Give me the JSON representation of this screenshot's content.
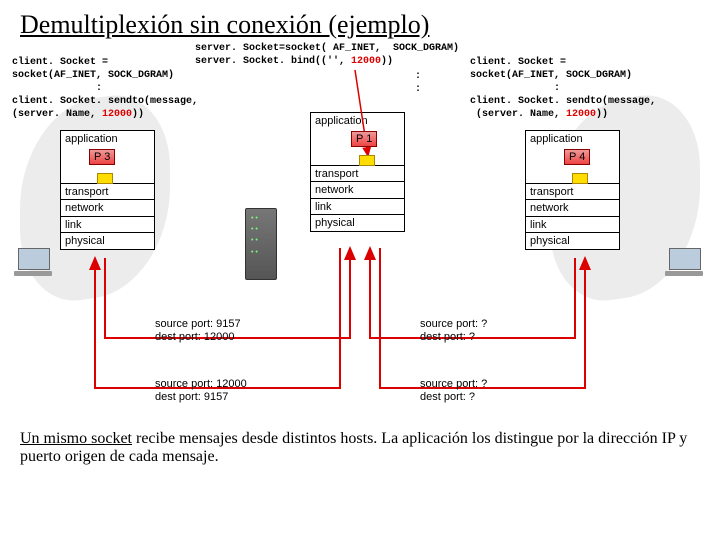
{
  "title": "Demultiplexión sin conexión (ejemplo)",
  "server_code_1": "server. Socket=socket( AF_INET,  SOCK_DGRAM)",
  "server_code_2": "server. Socket. bind(('', ",
  "server_code_2_port": "12000",
  "server_code_2_end": "))",
  "left_code_1": "client. Socket =",
  "left_code_2": "socket(AF_INET, SOCK_DGRAM)",
  "left_code_3": "              :",
  "left_code_4": "client. Socket. sendto(message,",
  "left_code_5": "(server. Name, ",
  "left_code_5_port": "12000",
  "left_code_5_end": "))",
  "right_code_1": "client. Socket =",
  "right_code_2": "socket(AF_INET, SOCK_DGRAM)",
  "right_code_3": "              :",
  "right_code_4": "client. Socket. sendto(message,",
  "right_code_5": " (server. Name, ",
  "right_code_5_port": "12000",
  "right_code_5_end": "))",
  "mid_dots1": ":",
  "mid_dots2": ":",
  "layers": {
    "application": "application",
    "transport": "transport",
    "network": "network",
    "link": "link",
    "physical": "physical"
  },
  "process_left": "P 3",
  "process_mid": "P 1",
  "process_right": "P 4",
  "packet1_a": "source port: 9157",
  "packet1_b": "dest port: 12000",
  "packet2_a": "source port: 12000",
  "packet2_b": "dest port: 9157",
  "packet3_a": "source port: ?",
  "packet3_b": "dest port: ?",
  "packet4_a": "source port: ?",
  "packet4_b": "dest port: ?",
  "footer_bold": "Un mismo socket",
  "footer_rest": " recibe mensajes desde distintos hosts. La aplicación los distingue por la dirección IP y puerto origen de cada mensaje.",
  "chart_data": {
    "type": "table",
    "title": "Connectionless demultiplexing example — three hosts, UDP sockets",
    "hosts": [
      {
        "role": "client",
        "process": "P3",
        "network_stack": [
          "application",
          "transport",
          "network",
          "link",
          "physical"
        ]
      },
      {
        "role": "server",
        "process": "P1",
        "network_stack": [
          "application",
          "transport",
          "network",
          "link",
          "physical"
        ],
        "binds_port": 12000
      },
      {
        "role": "client",
        "process": "P4",
        "network_stack": [
          "application",
          "transport",
          "network",
          "link",
          "physical"
        ]
      }
    ],
    "packets": [
      {
        "from": "P3",
        "to": "P1",
        "source_port": 9157,
        "dest_port": 12000
      },
      {
        "from": "P1",
        "to": "P3",
        "source_port": 12000,
        "dest_port": 9157
      },
      {
        "from": "P4",
        "to": "P1",
        "source_port": "?",
        "dest_port": "?"
      },
      {
        "from": "P1",
        "to": "P4",
        "source_port": "?",
        "dest_port": "?"
      }
    ]
  }
}
